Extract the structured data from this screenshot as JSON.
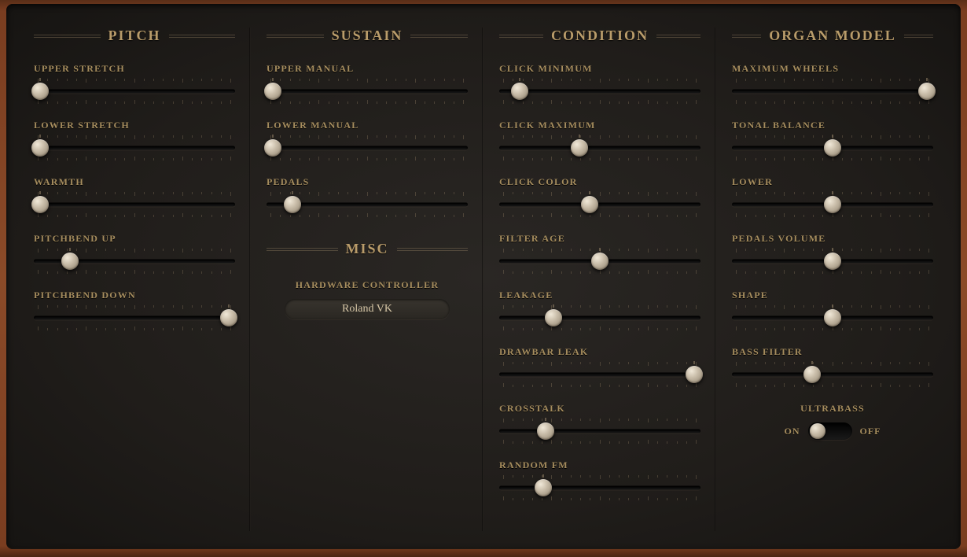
{
  "pitch": {
    "title": "PITCH",
    "sliders": [
      {
        "label": "UPPER STRETCH",
        "value": 3
      },
      {
        "label": "LOWER STRETCH",
        "value": 3
      },
      {
        "label": "WARMTH",
        "value": 3
      },
      {
        "label": "PITCHBEND UP",
        "value": 18
      },
      {
        "label": "PITCHBEND DOWN",
        "value": 97
      }
    ]
  },
  "sustain": {
    "title": "SUSTAIN",
    "sliders": [
      {
        "label": "UPPER MANUAL",
        "value": 3
      },
      {
        "label": "LOWER MANUAL",
        "value": 3
      },
      {
        "label": "PEDALS",
        "value": 13
      }
    ]
  },
  "misc": {
    "title": "MISC",
    "hardware_controller_label": "HARDWARE CONTROLLER",
    "hardware_controller_value": "Roland VK"
  },
  "condition": {
    "title": "CONDITION",
    "sliders": [
      {
        "label": "CLICK MINIMUM",
        "value": 10
      },
      {
        "label": "CLICK MAXIMUM",
        "value": 40
      },
      {
        "label": "CLICK COLOR",
        "value": 45
      },
      {
        "label": "FILTER AGE",
        "value": 50
      },
      {
        "label": "LEAKAGE",
        "value": 27
      },
      {
        "label": "DRAWBAR LEAK",
        "value": 97
      },
      {
        "label": "CROSSTALK",
        "value": 23
      },
      {
        "label": "RANDOM FM",
        "value": 22
      }
    ]
  },
  "organ_model": {
    "title": "ORGAN MODEL",
    "sliders": [
      {
        "label": "MAXIMUM WHEELS",
        "value": 97
      },
      {
        "label": "TONAL BALANCE",
        "value": 50
      },
      {
        "label": "LOWER",
        "value": 50
      },
      {
        "label": "PEDALS VOLUME",
        "value": 50
      },
      {
        "label": "SHAPE",
        "value": 50
      },
      {
        "label": "BASS FILTER",
        "value": 40
      }
    ],
    "ultrabass": {
      "label": "ULTRABASS",
      "on_label": "ON",
      "off_label": "OFF",
      "state": "on"
    }
  }
}
